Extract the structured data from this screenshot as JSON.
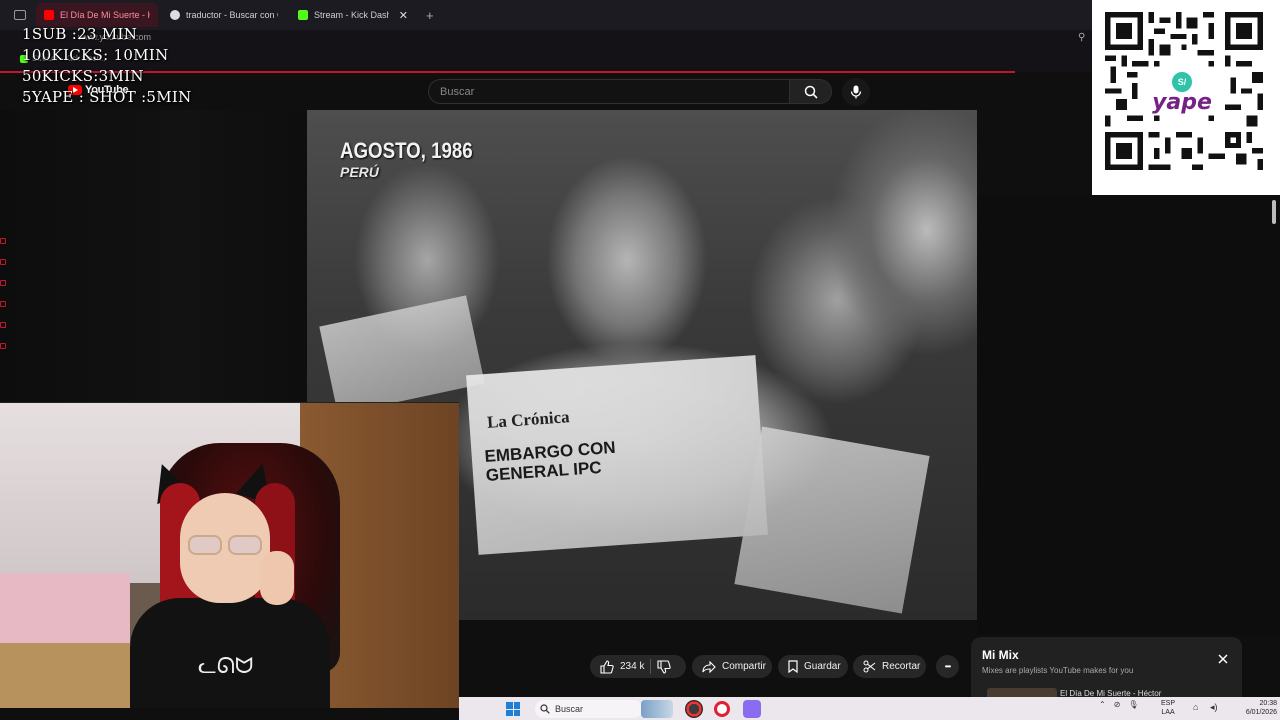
{
  "browser": {
    "tabs": [
      {
        "title": "El Día De Mi Suerte - Héct",
        "favicon_color": "#ff0000",
        "active": true
      },
      {
        "title": "traductor - Buscar con Go",
        "favicon_color": "#dddddd",
        "active": false
      },
      {
        "title": "Stream - Kick Dashboa",
        "favicon_color": "#53fc18",
        "active": false
      }
    ],
    "url_hint": "www.youtube.com",
    "bookmark": "Stream - Kick Dash..."
  },
  "overlay_lines": [
    "1SUB :23 MIN",
    "100KICKS: 10MIN",
    "50KICKS:3MIN",
    "5YAPE : SHOT :5MIN"
  ],
  "youtube": {
    "logo": "YouTube",
    "search_placeholder": "Buscar"
  },
  "video": {
    "caption_main": "AGOSTO, 1986",
    "caption_sub": "PERÚ",
    "newspaper_title": "La Crónica",
    "newspaper_headline": "EMBARGO CON GENERAL IPC"
  },
  "actions": {
    "likes": "234 k",
    "share": "Compartir",
    "save": "Guardar",
    "clip": "Recortar",
    "more": "•••"
  },
  "mix": {
    "title": "Mi Mix",
    "subtitle": "Mixes are playlists YouTube makes for you",
    "first_item": "El Día De Mi Suerte - Héctor"
  },
  "yape": {
    "label": "yape",
    "currency": "S/"
  },
  "taskbar": {
    "search_label": "Buscar",
    "lang": [
      "ESP",
      "LAA"
    ],
    "time": "20:38",
    "date": "6/01/2026"
  },
  "colors": {
    "accent": "#c2162b",
    "kick_green": "#53fc18",
    "yape_purple": "#742384"
  }
}
